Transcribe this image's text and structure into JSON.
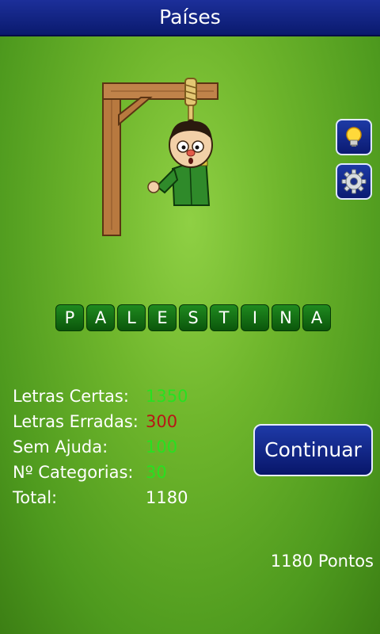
{
  "header": {
    "title": "Países"
  },
  "side_buttons": [
    {
      "icon": "lightbulb-icon"
    },
    {
      "icon": "gear-icon"
    }
  ],
  "word": {
    "letters": [
      "P",
      "A",
      "L",
      "E",
      "S",
      "T",
      "I",
      "N",
      "A"
    ]
  },
  "stats": [
    {
      "label": "Letras Certas:",
      "value": "1350",
      "color": "#28e020"
    },
    {
      "label": "Letras Erradas:",
      "value": "300",
      "color": "#b81616"
    },
    {
      "label": "Sem Ajuda:",
      "value": "100",
      "color": "#28e020"
    },
    {
      "label": "Nº Categorias:",
      "value": "30",
      "color": "#28e020"
    },
    {
      "label": "Total:",
      "value": "1180",
      "color": "#ffffff"
    }
  ],
  "actions": {
    "continue_label": "Continuar"
  },
  "footer": {
    "points": "1180 Pontos"
  },
  "colors": {
    "title_bar": "#0f2280",
    "tile_green": "#15701a",
    "correct": "#28e020",
    "wrong": "#b81616"
  }
}
